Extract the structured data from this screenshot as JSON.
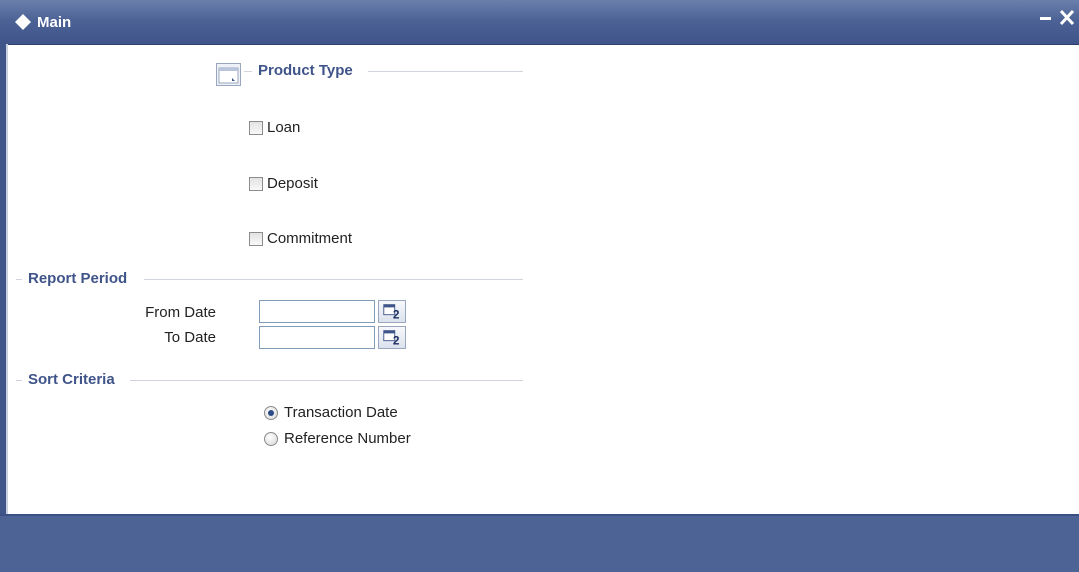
{
  "window": {
    "title": "Main",
    "minimize_icon": "minimize-icon",
    "close_icon": "close-icon"
  },
  "product_type": {
    "title": "Product Type",
    "icon": "form-icon",
    "options": [
      {
        "label": "Loan",
        "checked": false
      },
      {
        "label": "Deposit",
        "checked": false
      },
      {
        "label": "Commitment",
        "checked": false
      }
    ]
  },
  "report_period": {
    "title": "Report Period",
    "from_label": "From Date",
    "from_value": "",
    "to_label": "To Date",
    "to_value": "",
    "calendar_icon": "calendar-icon"
  },
  "sort_criteria": {
    "title": "Sort Criteria",
    "options": [
      {
        "label": "Transaction Date",
        "selected": true
      },
      {
        "label": "Reference Number",
        "selected": false
      }
    ]
  },
  "colors": {
    "titlebar": "#4d6396",
    "section_title": "#3f5489",
    "footer": "#4d6396"
  }
}
